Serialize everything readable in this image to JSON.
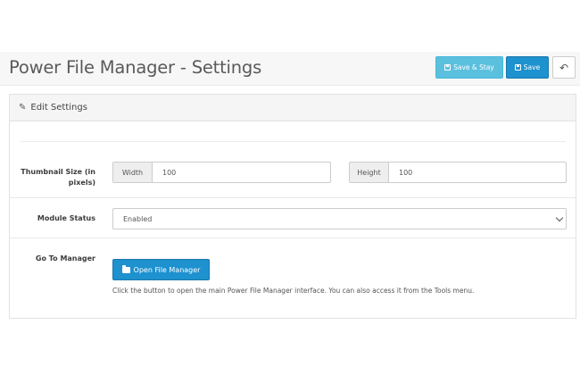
{
  "header": {
    "title": "Power File Manager - Settings",
    "save_stay_label": "Save & Stay",
    "save_label": "Save",
    "back_icon": "reply-icon"
  },
  "panel": {
    "title": "Edit Settings",
    "title_icon": "pencil-icon"
  },
  "thumbnail": {
    "label": "Thumbnail Size (in pixels)",
    "width_addon": "Width",
    "width_value": "100",
    "height_addon": "Height",
    "height_value": "100"
  },
  "module_status": {
    "label": "Module Status",
    "selected": "Enabled"
  },
  "manager": {
    "label": "Go To Manager",
    "button_label": "Open File Manager",
    "help_text": "Click the button to open the main Power File Manager interface. You can also access it from the Tools menu."
  },
  "colors": {
    "primary": "#1e91cf",
    "info": "#5bc0de",
    "heading_bg": "#f5f5f5"
  }
}
